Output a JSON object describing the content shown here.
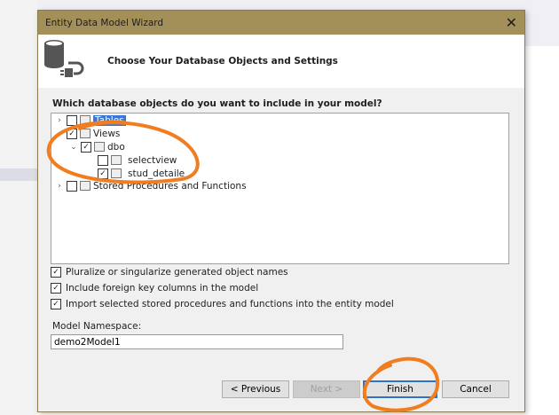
{
  "dialog": {
    "title": "Entity Data Model Wizard",
    "header": "Choose Your Database Objects and Settings",
    "question": "Which database objects do you want to include in your model?"
  },
  "tree": [
    {
      "label": "Tables",
      "checked": false
    },
    {
      "label": "Views",
      "checked": true
    },
    {
      "label": "dbo",
      "checked": true
    },
    {
      "label": "selectview",
      "checked": false
    },
    {
      "label": "stud_detaile",
      "checked": true
    },
    {
      "label": "Stored Procedures and Functions",
      "checked": false
    }
  ],
  "options": [
    {
      "label": "Pluralize or singularize generated object names",
      "checked": true
    },
    {
      "label": "Include foreign key columns in the model",
      "checked": true
    },
    {
      "label": "Import selected stored procedures and functions into the entity model",
      "checked": true
    }
  ],
  "namespace": {
    "label": "Model Namespace:",
    "value": "demo2Model1"
  },
  "buttons": {
    "previous": "< Previous",
    "next": "Next >",
    "finish": "Finish",
    "cancel": "Cancel"
  },
  "colors": {
    "titlebar": "#a38f58",
    "annotation": "#f07d20"
  }
}
